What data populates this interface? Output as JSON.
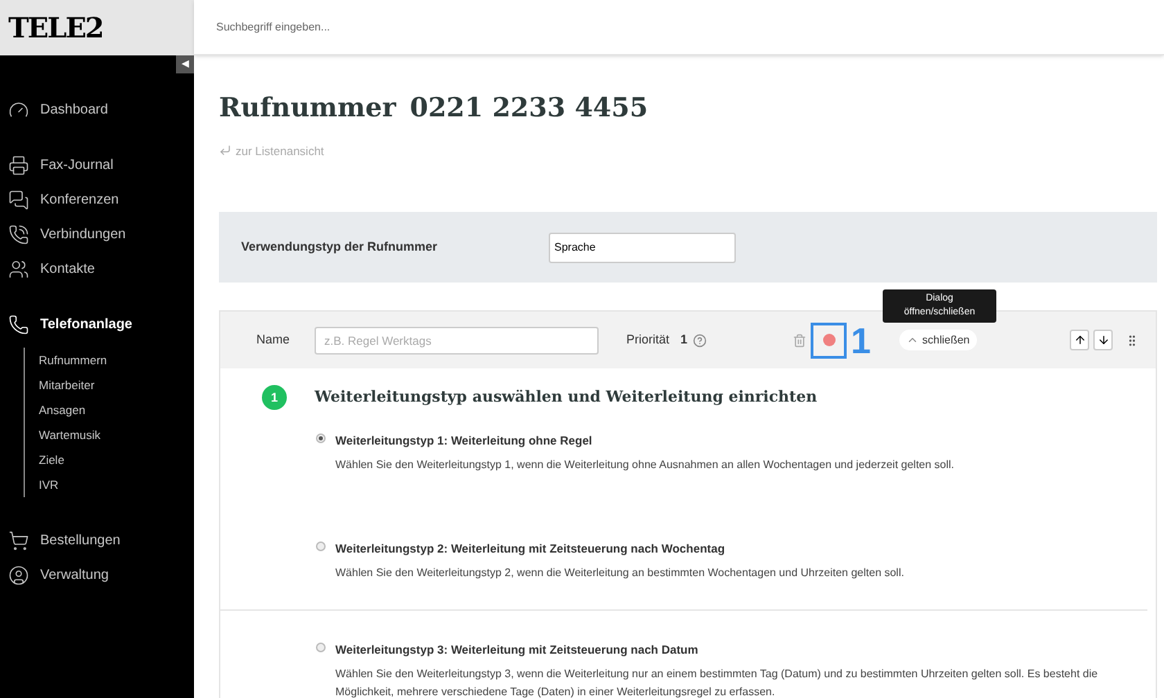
{
  "logo": {
    "text": "TELE2"
  },
  "search": {
    "placeholder": "Suchbegriff eingeben..."
  },
  "sidebar": {
    "collapse_glyph": "◀",
    "groups": [
      [
        {
          "label": "Dashboard",
          "selected": false
        }
      ],
      [
        {
          "label": "Fax-Journal",
          "selected": false
        },
        {
          "label": "Konferenzen",
          "selected": false
        },
        {
          "label": "Verbindungen",
          "selected": false
        },
        {
          "label": "Kontakte",
          "selected": false
        }
      ],
      [
        {
          "label": "Telefonanlage",
          "selected": true,
          "children": [
            {
              "label": "Rufnummern"
            },
            {
              "label": "Mitarbeiter"
            },
            {
              "label": "Ansagen"
            },
            {
              "label": "Wartemusik"
            },
            {
              "label": "Ziele"
            },
            {
              "label": "IVR"
            }
          ]
        }
      ],
      [
        {
          "label": "Bestellungen",
          "selected": false
        },
        {
          "label": "Verwaltung",
          "selected": false
        }
      ]
    ]
  },
  "page": {
    "title": "Rufnummer",
    "number": "0221 2233 4455",
    "back_link": "zur Listenansicht"
  },
  "usage": {
    "label": "Verwendungstyp der Rufnummer",
    "value": "Sprache"
  },
  "rule": {
    "name_label": "Name",
    "name_placeholder": "z.B. Regel Werktags",
    "priority_label": "Priorität",
    "priority": "1",
    "annotation": "1",
    "toggle_label": "schließen",
    "tooltip": "Dialog öffnen/schließen",
    "step": {
      "number": "1",
      "title": "Weiterleitungstyp auswählen und Weiterleitung einrichten"
    },
    "options": [
      {
        "title": "Weiterleitungstyp 1: Weiterleitung ohne Regel",
        "description": "Wählen Sie den Weiterleitungstyp 1, wenn die Weiterleitung ohne Ausnahmen an allen Wochentagen und jederzeit gelten soll.",
        "selected": true
      },
      {
        "title": "Weiterleitungstyp 2: Weiterleitung mit Zeitsteuerung nach Wochentag",
        "description": "Wählen Sie den Weiterleitungstyp 2, wenn die Weiterleitung an bestimmten Wochentagen und Uhrzeiten gelten soll.",
        "selected": false
      },
      {
        "title": "Weiterleitungstyp 3: Weiterleitung mit Zeitsteuerung nach Datum",
        "description": "Wählen Sie den Weiterleitungstyp 3, wenn die Weiterleitung nur an einem bestimmten Tag (Datum) und zu bestimmten Uhrzeiten gelten soll. Es besteht die Möglichkeit, mehrere verschiedene Tage (Daten) in einer Weiterleitungsregel zu erfassen.",
        "selected": false
      }
    ]
  }
}
